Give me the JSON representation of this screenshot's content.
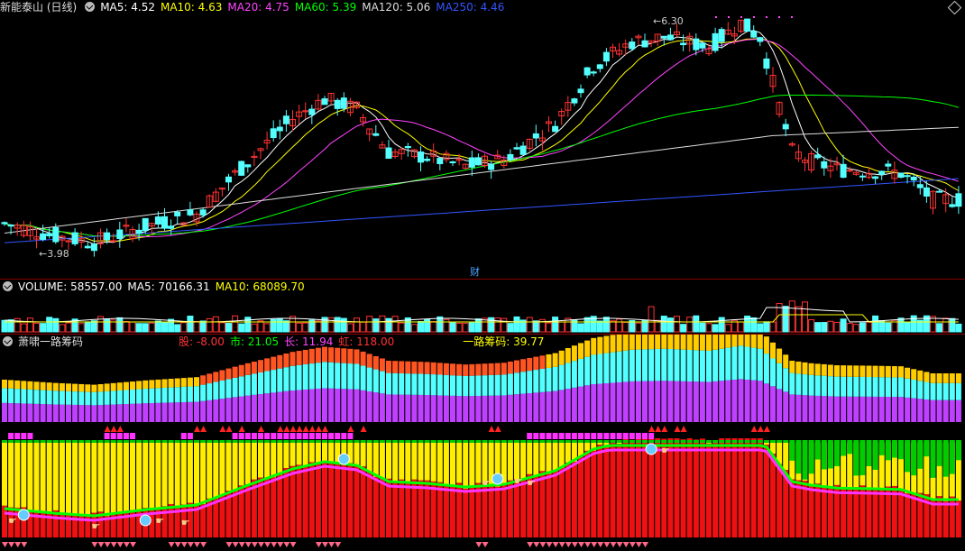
{
  "price_pane": {
    "title": "新能泰山 (日线)",
    "indicators": [
      {
        "label": "MA5: 4.52",
        "color": "#ffffff"
      },
      {
        "label": "MA10: 4.63",
        "color": "#ffff00"
      },
      {
        "label": "MA20: 4.75",
        "color": "#ff44ff"
      },
      {
        "label": "MA60: 5.39",
        "color": "#00ff00"
      },
      {
        "label": "MA120: 5.06",
        "color": "#dddddd"
      },
      {
        "label": "MA250: 4.46",
        "color": "#3355ff"
      }
    ],
    "high_label": "6.30",
    "low_label": "3.98",
    "finance_marker": "财"
  },
  "volume_pane": {
    "indicators": [
      {
        "label": "VOLUME: 58557.00",
        "color": "#ffffff"
      },
      {
        "label": "MA5: 70166.31",
        "color": "#ffffff"
      },
      {
        "label": "MA10: 68089.70",
        "color": "#ffff00"
      }
    ]
  },
  "chip_pane": {
    "title": "萧啸一路筹码",
    "indicators": [
      {
        "label": "股: -8.00",
        "color": "#ff3333"
      },
      {
        "label": "市: 21.05",
        "color": "#00ff00"
      },
      {
        "label": "长: 11.94",
        "color": "#ff44ff"
      },
      {
        "label": "虹: 118.00",
        "color": "#ff3333"
      }
    ],
    "indicator2": {
      "label": "一路筹码: 39.77",
      "color": "#ffff00"
    }
  },
  "colors": {
    "up": "#ff3333",
    "down": "#54ffff",
    "separator": "#8b0000",
    "ma5": "#ffffff",
    "ma10": "#ffff00",
    "ma20": "#ff44ff",
    "ma60": "#00ff00",
    "ma120": "#dddddd",
    "ma250": "#3355ff"
  }
}
